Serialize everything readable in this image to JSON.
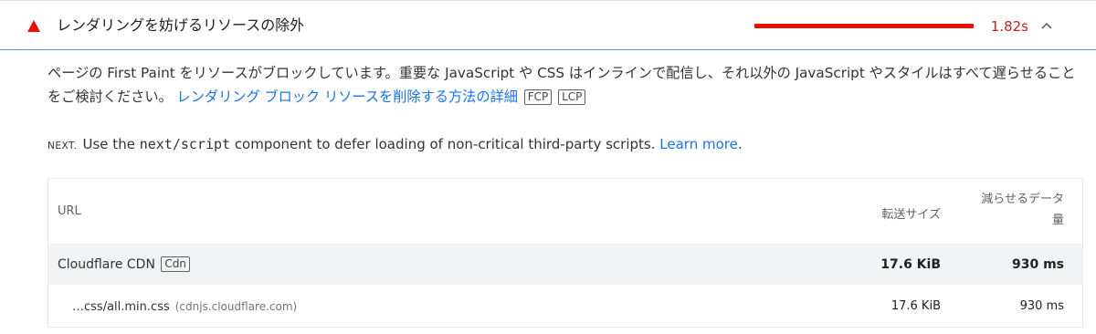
{
  "audit": {
    "title": "レンダリングを妨げるリソースの除外",
    "metric": "1.82s",
    "status_color": "#eb0f00",
    "description_text": "ページの First Paint をリソースがブロックしています。重要な JavaScript や CSS はインラインで配信し、それ以外の JavaScript やスタイルはすべて遅らせることをご検討ください。",
    "description_link": "レンダリング ブロック リソースを削除する方法の詳細",
    "tags": [
      "FCP",
      "LCP"
    ]
  },
  "stack_pack": {
    "logo_text": "NEXT.",
    "text_before": "Use the ",
    "code": "next/script",
    "text_after": " component to defer loading of non-critical third-party scripts. ",
    "link": "Learn more",
    "period": "."
  },
  "table": {
    "headers": {
      "url": "URL",
      "size": "転送サイズ",
      "wasted_line1": "減らせるデータ",
      "wasted_line2": "量"
    },
    "group": {
      "name": "Cloudflare CDN",
      "badge": "Cdn",
      "size": "17.6 KiB",
      "wasted": "930 ms"
    },
    "rows": [
      {
        "name": "…css/all.min.css",
        "domain": "(cdnjs.cloudflare.com)",
        "size": "17.6 KiB",
        "wasted": "930 ms"
      }
    ]
  }
}
